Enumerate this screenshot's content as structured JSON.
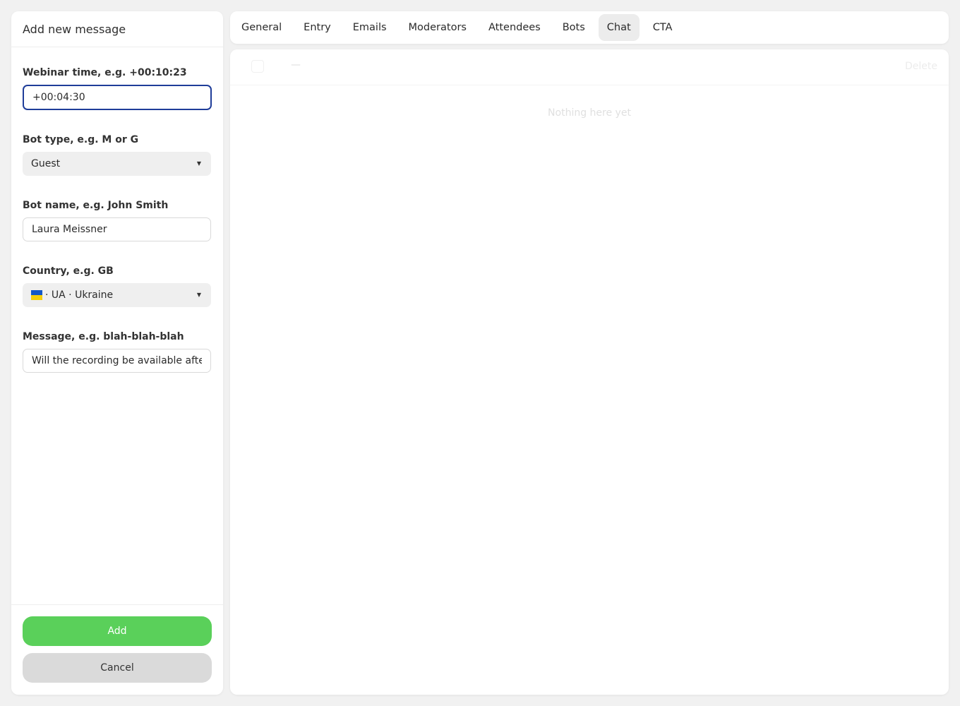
{
  "form": {
    "title": "Add new message",
    "webinar_time": {
      "label": "Webinar time, e.g. +00:10:23",
      "value": "+00:04:30"
    },
    "bot_type": {
      "label": "Bot type, e.g. M or G",
      "value": "Guest"
    },
    "bot_name": {
      "label": "Bot name, e.g. John Smith",
      "value": "Laura Meissner"
    },
    "country": {
      "label": "Country, e.g. GB",
      "value": "· UA · Ukraine",
      "flag_colors": [
        "#1357c7",
        "#f5cf0b"
      ]
    },
    "message": {
      "label": "Message, e.g. blah-blah-blah",
      "value": "Will the recording be available after the webinar?"
    },
    "add_label": "Add",
    "cancel_label": "Cancel"
  },
  "tabs": [
    {
      "label": "General"
    },
    {
      "label": "Entry"
    },
    {
      "label": "Emails"
    },
    {
      "label": "Moderators"
    },
    {
      "label": "Attendees"
    },
    {
      "label": "Bots"
    },
    {
      "label": "Chat",
      "active": true
    },
    {
      "label": "CTA"
    }
  ],
  "content": {
    "dash": "—",
    "delete_label": "Delete",
    "empty_text": "Nothing here yet"
  },
  "colors": {
    "add_button": "#5ad05a",
    "cancel_button": "#dadada",
    "focus_border": "#1f3d99",
    "active_tab": "#ececec"
  }
}
